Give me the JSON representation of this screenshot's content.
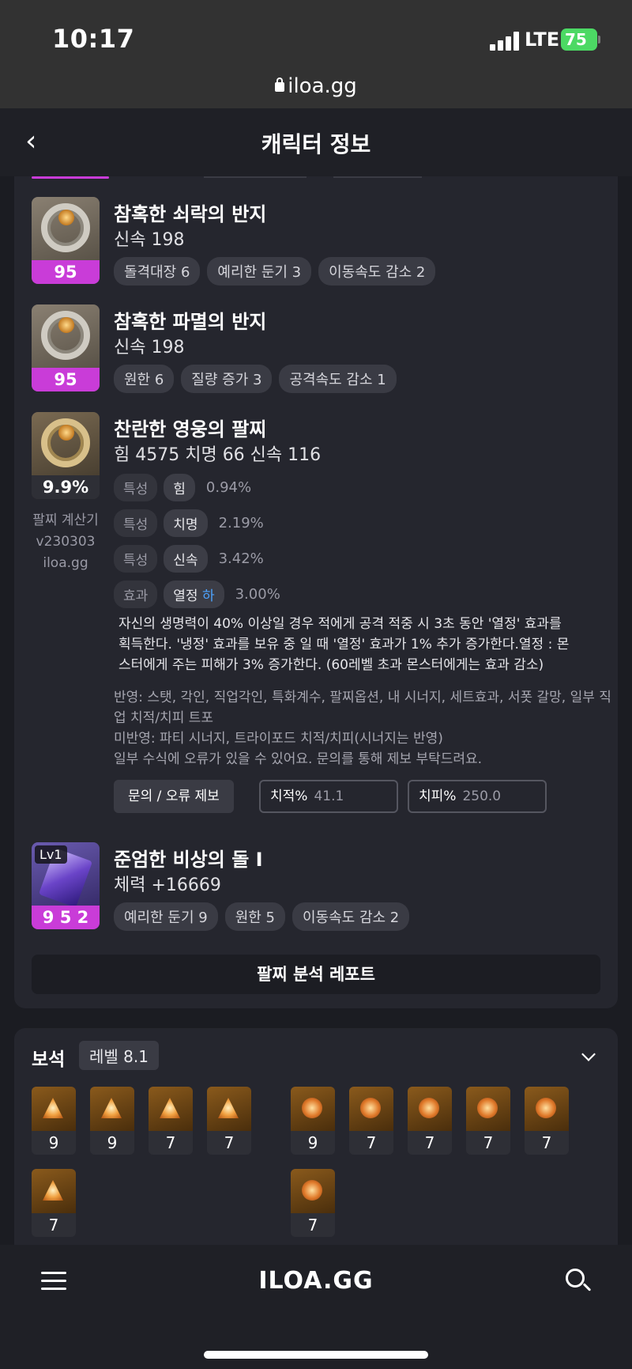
{
  "status_bar": {
    "time": "10:17",
    "network": "LTE",
    "battery": "75"
  },
  "browser": {
    "url": "iloa.gg"
  },
  "header": {
    "title": "캐릭터 정보"
  },
  "accessories": [
    {
      "name": "참혹한 쇠락의 반지",
      "stat": "신속 198",
      "quality": "95",
      "tags": [
        "돌격대장 6",
        "예리한 둔기 3",
        "이동속도 감소 2"
      ]
    },
    {
      "name": "참혹한 파멸의 반지",
      "stat": "신속 198",
      "quality": "95",
      "tags": [
        "원한 6",
        "질량 증가 3",
        "공격속도 감소 1"
      ]
    }
  ],
  "bracelet": {
    "name": "찬란한 영웅의 팔찌",
    "stats": "힘 4575  치명 66  신속 116",
    "percent": "9.9%",
    "calc_label": "팔찌 계산기",
    "calc_version": "v230303",
    "calc_site": "iloa.gg",
    "options": [
      {
        "key": "특성",
        "val": "힘",
        "pct": "0.94%"
      },
      {
        "key": "특성",
        "val": "치명",
        "pct": "2.19%"
      },
      {
        "key": "특성",
        "val": "신속",
        "pct": "3.42%"
      }
    ],
    "effect": {
      "key": "효과",
      "val": "열정",
      "grade": "하",
      "pct": "3.00%"
    },
    "effect_desc": "자신의 생명력이 40% 이상일 경우 적에게 공격 적중 시 3초 동안 '열정' 효과를 획득한다. '냉정' 효과를 보유 중 일 때 '열정' 효과가 1% 추가 증가한다.열정 : 몬스터에게 주는 피해가 3% 증가한다. (60레벨 초과 몬스터에게는 효과 감소)",
    "notes": [
      "반영: 스탯, 각인, 직업각인, 특화계수, 팔찌옵션, 내 시너지, 세트효과, 서폿 갈망, 일부 직업 치적/치피 트포",
      "미반영: 파티 시너지, 트라이포드 치적/치피(시너지는 반영)",
      "일부 수식에 오류가 있을 수 있어요. 문의를 통해 제보 부탁드려요."
    ],
    "report_button": "문의 / 오류 제보",
    "crit_rate_label": "치적%",
    "crit_rate_value": "41.1",
    "crit_dmg_label": "치피%",
    "crit_dmg_value": "250.0"
  },
  "stone": {
    "level_badge": "Lv1",
    "name": "준엄한 비상의 돌 I",
    "stat": "체력 +16669",
    "quality": "9 5 2",
    "tags": [
      "예리한 둔기 9",
      "원한 5",
      "이동속도 감소 2"
    ]
  },
  "analysis_button": "팔찌 분석 레포트",
  "gems": {
    "title": "보석",
    "level": "레벨 8.1",
    "left": [
      "9",
      "9",
      "7",
      "7",
      "7"
    ],
    "right": [
      "9",
      "7",
      "7",
      "7",
      "7",
      "7"
    ]
  },
  "bottom_nav": {
    "brand": "ILOA.GG"
  }
}
